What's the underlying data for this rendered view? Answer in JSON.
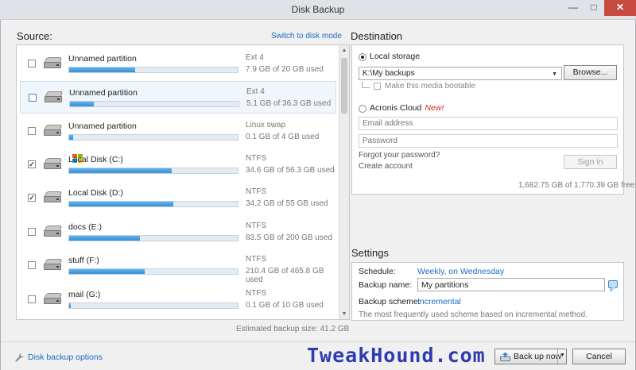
{
  "window": {
    "title": "Disk Backup",
    "controls": {
      "minimize": "—",
      "maximize": "□",
      "close": "✕"
    }
  },
  "source": {
    "title": "Source:",
    "switch_link": "Switch to disk mode",
    "partitions": [
      {
        "name": "Unnamed partition",
        "fs": "Ext 4",
        "usage": "7.9 GB of 20 GB used",
        "used_fraction": 0.39,
        "checked": false,
        "selected": false,
        "icon": "hard-disk-icon"
      },
      {
        "name": "Unnamed partition",
        "fs": "Ext 4",
        "usage": "5.1 GB of 36.3 GB used",
        "used_fraction": 0.14,
        "checked": false,
        "selected": true,
        "icon": "hard-disk-icon"
      },
      {
        "name": "Unnamed partition",
        "fs": "Linux swap",
        "usage": "0.1 GB of 4 GB used",
        "used_fraction": 0.025,
        "checked": false,
        "selected": false,
        "icon": "hard-disk-icon"
      },
      {
        "name": "Local Disk (C:)",
        "fs": "NTFS",
        "usage": "34.6 GB of 56.3 GB used",
        "used_fraction": 0.61,
        "checked": true,
        "selected": false,
        "icon": "windows-disk-icon"
      },
      {
        "name": "Local Disk (D:)",
        "fs": "NTFS",
        "usage": "34.2 GB of 55 GB used",
        "used_fraction": 0.62,
        "checked": true,
        "selected": false,
        "icon": "hard-disk-icon"
      },
      {
        "name": "docs (E:)",
        "fs": "NTFS",
        "usage": "83.5 GB of 200 GB used",
        "used_fraction": 0.42,
        "checked": false,
        "selected": false,
        "icon": "hard-disk-icon"
      },
      {
        "name": "stuff (F:)",
        "fs": "NTFS",
        "usage": "210.4 GB of 465.8 GB used",
        "used_fraction": 0.45,
        "checked": false,
        "selected": false,
        "icon": "hard-disk-icon"
      },
      {
        "name": "mail (G:)",
        "fs": "NTFS",
        "usage": "0.1 GB of 10 GB used",
        "used_fraction": 0.01,
        "checked": false,
        "selected": false,
        "icon": "hard-disk-icon"
      }
    ],
    "estimated_size": "Estimated backup size: 41.2 GB"
  },
  "destination": {
    "title": "Destination",
    "local_storage_label": "Local storage",
    "path_value": "K:\\My backups",
    "browse_label": "Browse...",
    "bootable_label": "Make this media bootable",
    "cloud_label": "Acronis Cloud",
    "cloud_badge": "New!",
    "email_placeholder": "Email address",
    "password_placeholder": "Password",
    "forgot_label": "Forgot your password?",
    "create_label": "Create account",
    "signin_label": "Sign in",
    "free_space": "1,682.75 GB of 1,770.39 GB free"
  },
  "settings": {
    "title": "Settings",
    "schedule_label": "Schedule:",
    "schedule_value": "Weekly, on Wednesday",
    "name_label": "Backup name:",
    "name_value": "My partitions",
    "scheme_label": "Backup scheme:",
    "scheme_value": "Incremental",
    "scheme_desc": "The most frequently used scheme based on incremental method."
  },
  "footer": {
    "options_label": "Disk backup options",
    "watermark": "TweakHound.com",
    "backup_label": "Back up now",
    "cancel_label": "Cancel"
  },
  "colors": {
    "accent": "#1a6bc2",
    "bar_fill": "#3490d6",
    "close_button": "#c74a3f",
    "new_badge": "#d9261c",
    "watermark": "#2f3bb0"
  }
}
